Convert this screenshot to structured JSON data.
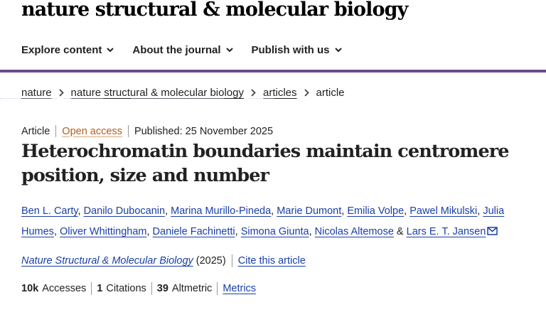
{
  "header": {
    "logo": "nature structural & molecular biology"
  },
  "nav": {
    "items": [
      {
        "label": "Explore content"
      },
      {
        "label": "About the journal"
      },
      {
        "label": "Publish with us"
      }
    ]
  },
  "breadcrumb": {
    "items": [
      "nature",
      "nature structural & molecular biology",
      "articles"
    ],
    "current": "article"
  },
  "article": {
    "type": "Article",
    "access": "Open access",
    "published": "Published: 25 November 2025",
    "title": "Heterochromatin boundaries maintain centromere position, size and number",
    "authors": [
      "Ben L. Carty",
      "Danilo Dubocanin",
      "Marina Murillo-Pineda",
      "Marie Dumont",
      "Emilia Volpe",
      "Pawel Mikulski",
      "Julia Humes",
      "Oliver Whittingham",
      "Daniele Fachinetti",
      "Simona Giunta",
      "Nicolas Altemose",
      "Lars E. T. Jansen"
    ],
    "author_sep": ", ",
    "author_and": " & ",
    "journal": "Nature Structural & Molecular Biology",
    "year": "(2025)",
    "cite": "Cite this article"
  },
  "metrics": {
    "accesses_value": "10k",
    "accesses_label": "Accesses",
    "citations_value": "1",
    "citations_label": "Citations",
    "altmetric_value": "39",
    "altmetric_label": "Altmetric",
    "metrics_link": "Metrics"
  },
  "colors": {
    "accent": "#6c4b8f",
    "link": "#1a3ea8",
    "open_access": "#b35c1e"
  },
  "icons": {
    "nav_chevron": "chevron-down-icon",
    "breadcrumb_sep": "chevron-right-icon",
    "corresponding": "mail-icon"
  }
}
